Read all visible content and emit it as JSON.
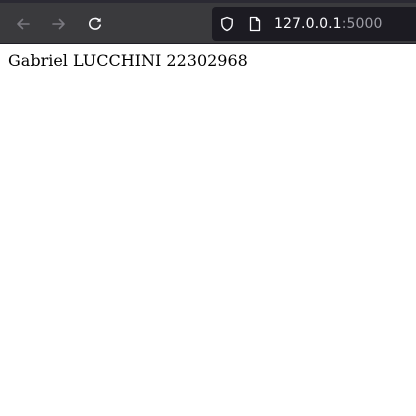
{
  "browser": {
    "nav": {
      "back_icon": "arrow-left-icon",
      "forward_icon": "arrow-right-icon",
      "reload_icon": "reload-icon"
    },
    "urlbar": {
      "security_icon": "shield-icon",
      "page_icon": "page-icon",
      "host": "127.0.0.1",
      "port": ":5000"
    },
    "colors": {
      "toolbar": "#3a3a3d",
      "urlbar": "#1c1b22",
      "url_host": "#fbfbfe",
      "url_port": "#9e9ea6"
    }
  },
  "page": {
    "text": "Gabriel LUCCHINI 22302968"
  }
}
